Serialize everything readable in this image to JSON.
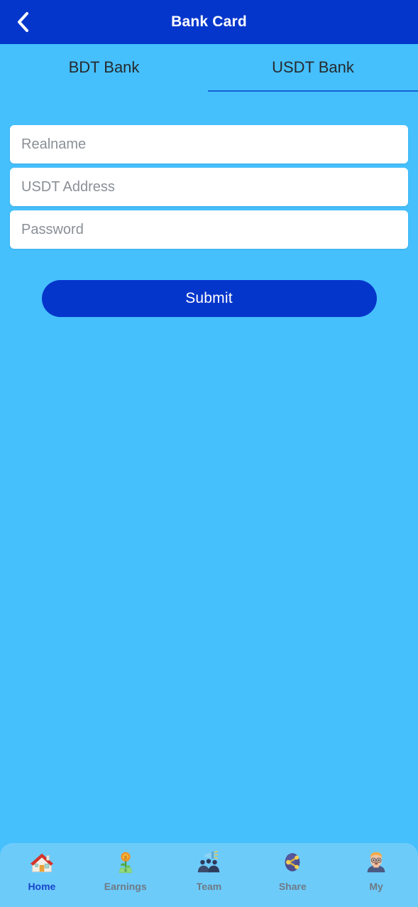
{
  "header": {
    "title": "Bank Card",
    "back_icon": "chevron-left-icon",
    "background_color": "#0536CC",
    "text_color": "#FFFFFF"
  },
  "page": {
    "background_color": "#45C0FD"
  },
  "tabs": [
    {
      "label": "BDT Bank",
      "active": false
    },
    {
      "label": "USDT Bank",
      "active": true
    }
  ],
  "form": {
    "fields": [
      {
        "name": "realname",
        "placeholder": "Realname",
        "value": "",
        "type": "text"
      },
      {
        "name": "usdt-address",
        "placeholder": "USDT Address",
        "value": "",
        "type": "text"
      },
      {
        "name": "password",
        "placeholder": "Password",
        "value": "",
        "type": "password"
      }
    ],
    "submit_label": "Submit",
    "submit_color": "#0536CC"
  },
  "bottom_nav": {
    "background_color": "#6DCBFA",
    "active_color": "#1744C9",
    "inactive_color": "#6E7A85",
    "items": [
      {
        "label": "Home",
        "icon": "house-icon",
        "glyph": "🏠",
        "active": true
      },
      {
        "label": "Earnings",
        "icon": "money-plant-icon",
        "glyph": "💰",
        "active": false
      },
      {
        "label": "Team",
        "icon": "people-group-icon",
        "glyph": "👥",
        "active": false
      },
      {
        "label": "Share",
        "icon": "share-node-icon",
        "glyph": "🔗",
        "active": false
      },
      {
        "label": "My",
        "icon": "person-face-icon",
        "glyph": "👨",
        "active": false
      }
    ]
  }
}
